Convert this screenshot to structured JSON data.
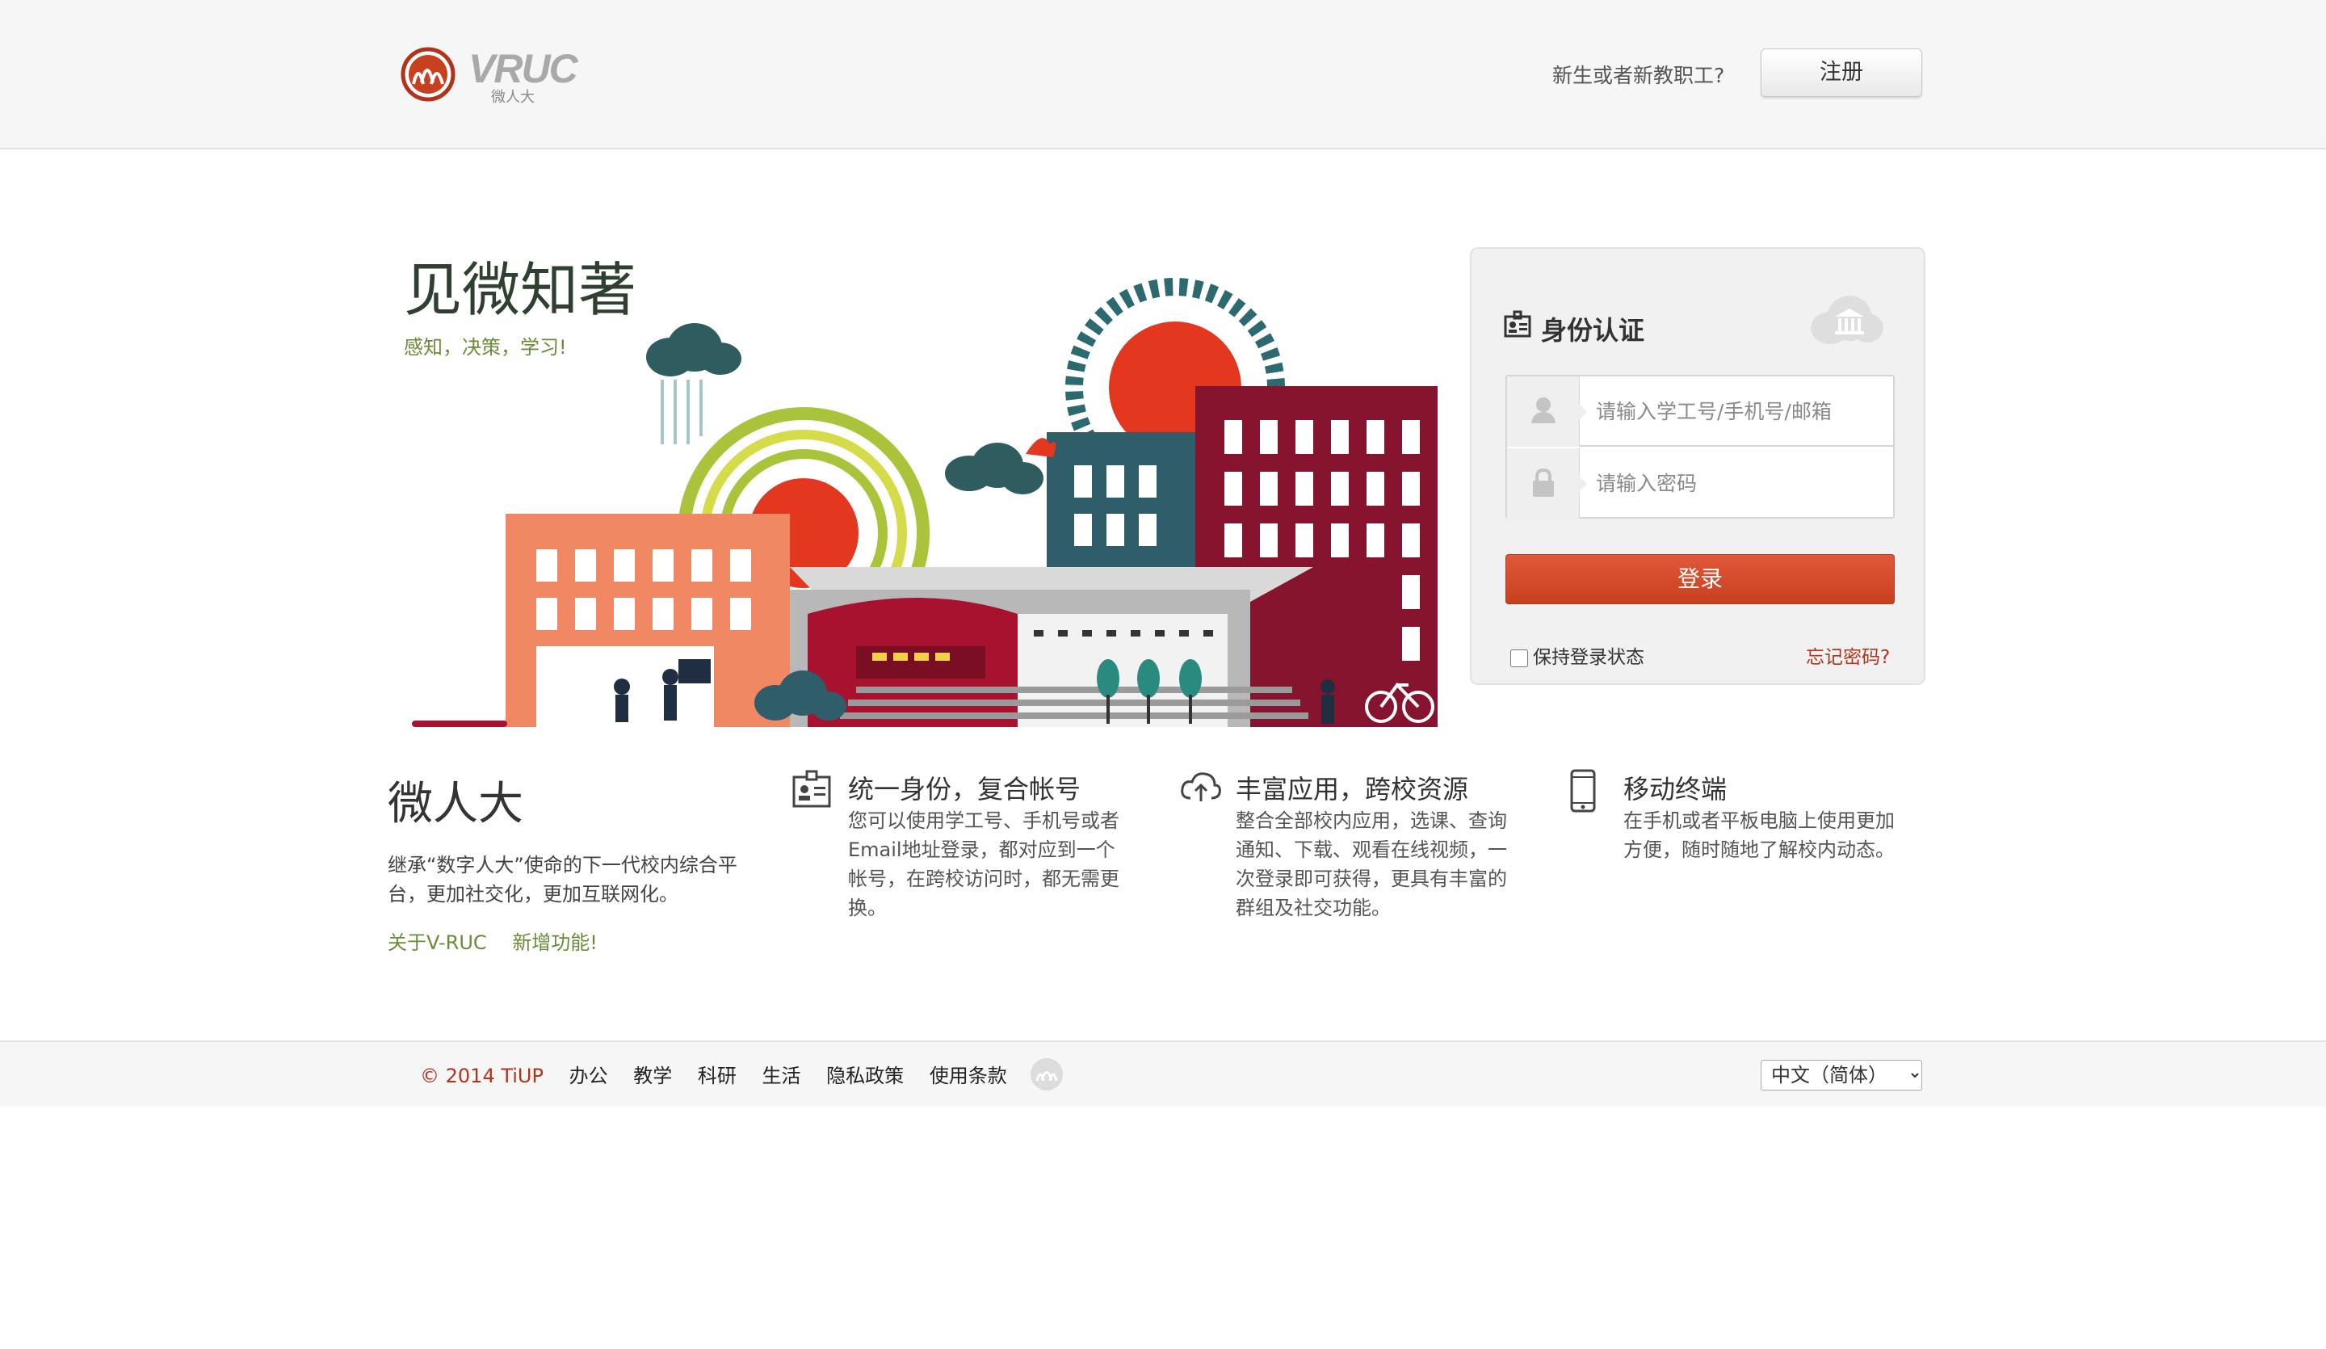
{
  "header": {
    "logo_text": "VRUC",
    "logo_subtitle": "微人大",
    "register_prompt": "新生或者新教职工?",
    "register_label": "注册"
  },
  "hero": {
    "title": "见微知著",
    "subtitle": "感知，决策，学习!"
  },
  "login": {
    "title": "身份认证",
    "username_placeholder": "请输入学工号/手机号/邮箱",
    "password_placeholder": "请输入密码",
    "submit_label": "登录",
    "remember_label": "保持登录状态",
    "forgot_label": "忘记密码?"
  },
  "about": {
    "title": "微人大",
    "description": "继承“数字人大”使命的下一代校内综合平台，更加社交化，更加互联网化。",
    "links": [
      "关于V-RUC",
      "新增功能!"
    ]
  },
  "features": [
    {
      "icon": "id-card-icon",
      "title": "统一身份，复合帐号",
      "description": "您可以使用学工号、手机号或者Email地址登录，都对应到一个帐号，在跨校访问时，都无需更换。"
    },
    {
      "icon": "cloud-upload-icon",
      "title": "丰富应用，跨校资源",
      "description": "整合全部校内应用，选课、查询通知、下载、观看在线视频，一次登录即可获得，更具有丰富的群组及社交功能。"
    },
    {
      "icon": "mobile-phone-icon",
      "title": "移动终端",
      "description": "在手机或者平板电脑上使用更加方便，随时随地了解校内动态。"
    }
  ],
  "footer": {
    "copyright": "© 2014 TiUP",
    "links": [
      "办公",
      "教学",
      "科研",
      "生活",
      "隐私政策",
      "使用条款"
    ],
    "language_selected": "中文（简体）"
  },
  "colors": {
    "accent_red": "#c7401f",
    "brand_green": "#6c8a38",
    "building_maroon": "#86142f",
    "building_salmon": "#f08864",
    "sun_red": "#e33720"
  }
}
